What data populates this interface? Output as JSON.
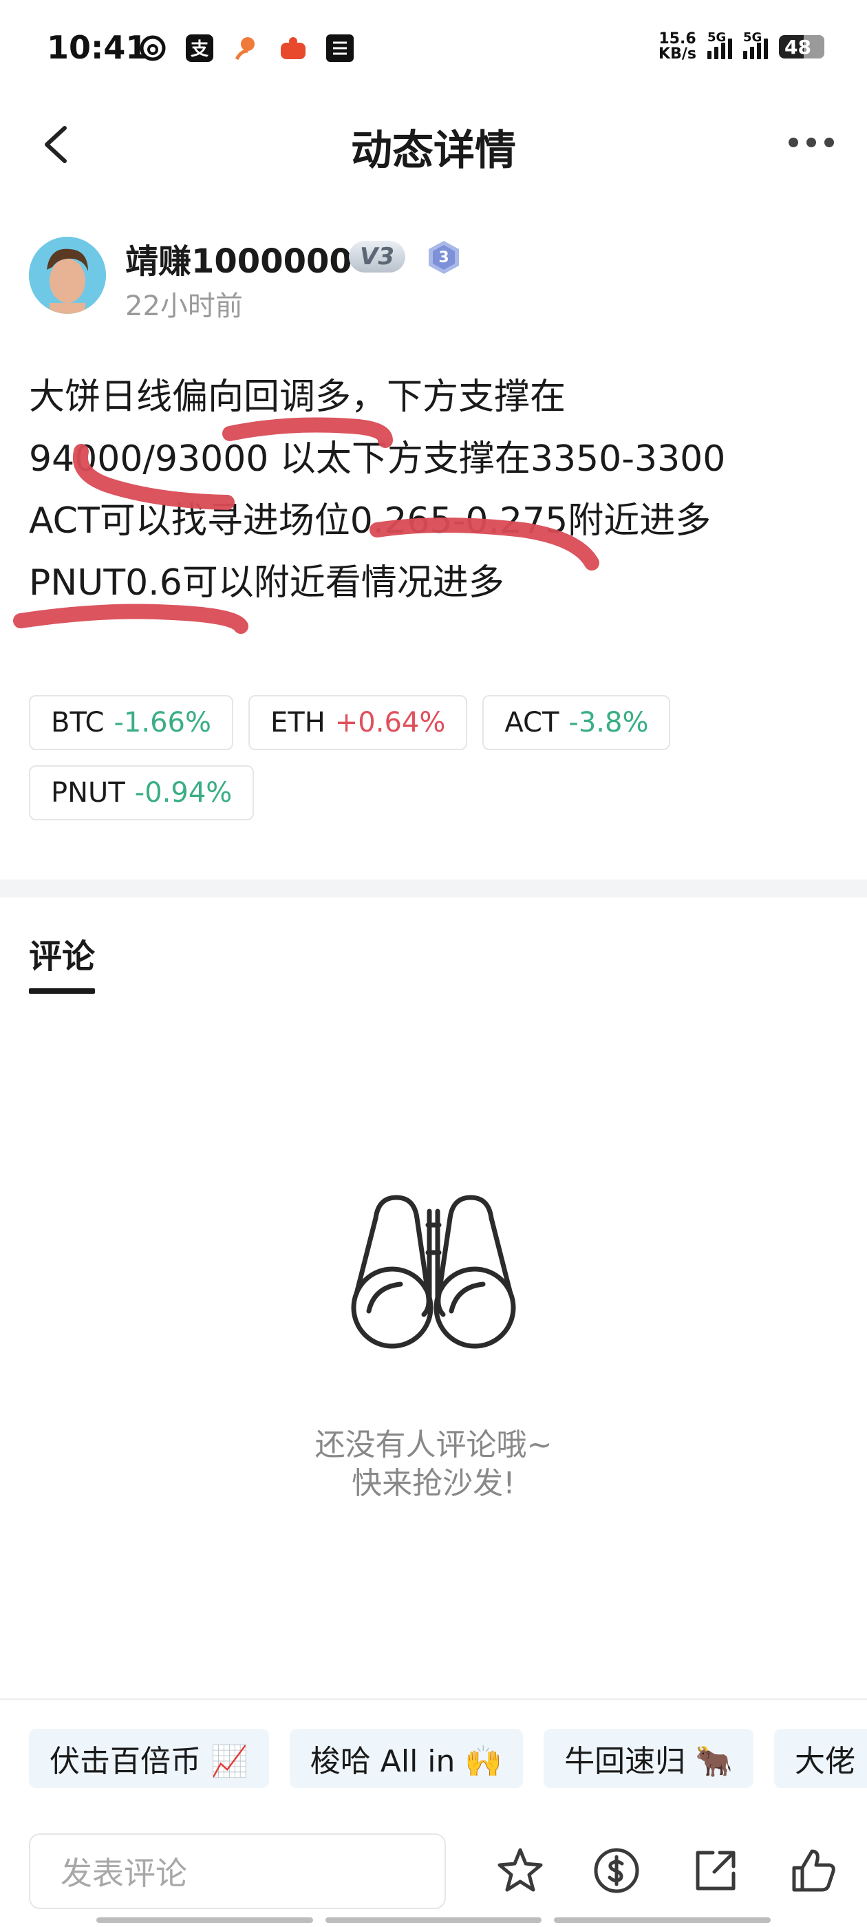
{
  "status_bar": {
    "time": "10:41",
    "net_speed_value": "15.6",
    "net_speed_unit": "KB/s",
    "signal_1": "5G",
    "signal_2": "5G",
    "battery": "48",
    "app_icons": [
      "netease-icon",
      "alipay-icon",
      "taobao-icon",
      "app-icon",
      "capcut-icon"
    ]
  },
  "header": {
    "title": "动态详情"
  },
  "author": {
    "name": "靖赚1000000",
    "vip_level": "V3",
    "level_badge": "3",
    "time_ago": "22小时前"
  },
  "post": {
    "lines": [
      "大饼日线偏向回调多，下方支撑在",
      "94000/93000 以太下方支撑在3350-3300",
      "ACT可以找寻进场位0.265-0.275附近进多",
      "PNUT0.6可以附近看情况进多"
    ],
    "scribble_color": "#d94b55"
  },
  "tickers": [
    {
      "symbol": "BTC",
      "change": "-1.66%",
      "direction": "down"
    },
    {
      "symbol": "ETH",
      "change": "+0.64%",
      "direction": "up"
    },
    {
      "symbol": "ACT",
      "change": "-3.8%",
      "direction": "down"
    },
    {
      "symbol": "PNUT",
      "change": "-0.94%",
      "direction": "down"
    }
  ],
  "colors": {
    "down": "#3aae84",
    "up": "#e0505c"
  },
  "comments": {
    "tab_label": "评论",
    "empty_line_1": "还没有人评论哦~",
    "empty_line_2": "快来抢沙发!"
  },
  "quick_replies": [
    "伏击百倍币 📈",
    "梭哈 All in 🙌",
    "牛回速归 🐂",
    "大佬"
  ],
  "composer": {
    "placeholder": "发表评论"
  }
}
